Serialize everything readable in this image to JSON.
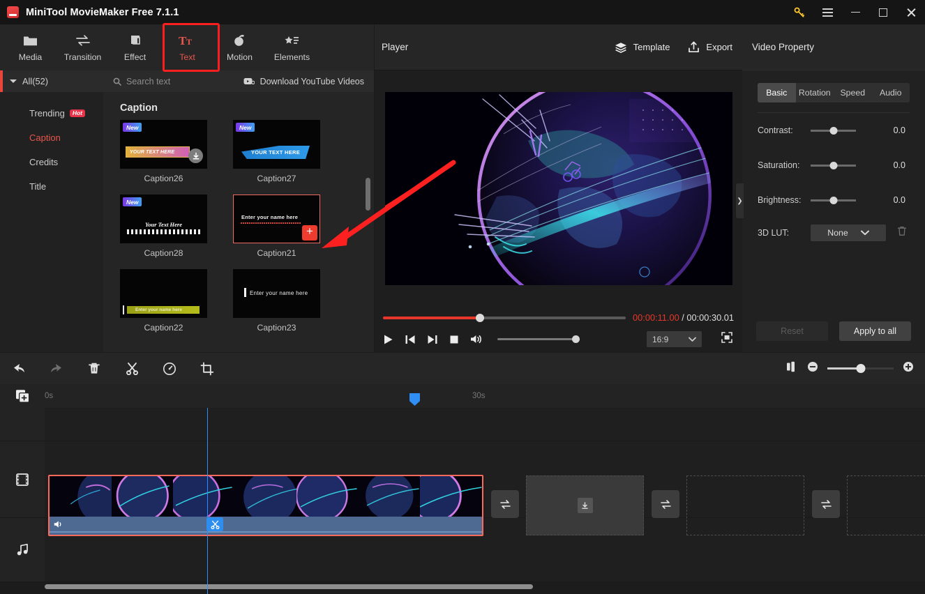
{
  "window": {
    "title": "MiniTool MovieMaker Free 7.1.1",
    "controls": {
      "key": "key-icon",
      "menu": "hamburger-icon",
      "minimize": "minimize-icon",
      "maximize": "maximize-icon",
      "close": "close-icon"
    }
  },
  "toolbar": {
    "tabs": [
      {
        "label": "Media",
        "icon": "folder-icon"
      },
      {
        "label": "Transition",
        "icon": "transition-arrows-icon"
      },
      {
        "label": "Effect",
        "icon": "layers-square-icon"
      },
      {
        "label": "Text",
        "icon": "text-tt-icon"
      },
      {
        "label": "Motion",
        "icon": "motion-ball-icon"
      },
      {
        "label": "Elements",
        "icon": "star-list-icon"
      }
    ],
    "active_tab": "Text"
  },
  "sidebar": {
    "all_label": "All(52)",
    "items": [
      {
        "label": "Trending",
        "badge": "Hot"
      },
      {
        "label": "Caption",
        "badge": ""
      },
      {
        "label": "Credits",
        "badge": ""
      },
      {
        "label": "Title",
        "badge": ""
      }
    ],
    "active_item": "Caption"
  },
  "library": {
    "search_placeholder": "Search text",
    "download_label": "Download YouTube Videos",
    "section_title": "Caption",
    "items": [
      {
        "label": "Caption26",
        "badge": "New",
        "art": "t26",
        "art_text": "YOUR TEXT HERE",
        "download": true,
        "selected": false
      },
      {
        "label": "Caption27",
        "badge": "New",
        "art": "t27",
        "art_text": "YOUR TEXT HERE",
        "download": false,
        "selected": false
      },
      {
        "label": "Caption28",
        "badge": "New",
        "art": "t28",
        "art_text": "Your Text Here",
        "download": false,
        "selected": false
      },
      {
        "label": "Caption21",
        "badge": "",
        "art": "t21",
        "art_text": "Enter your name here",
        "download": false,
        "selected": true
      },
      {
        "label": "Caption22",
        "badge": "",
        "art": "t22",
        "art_text": "Enter your name here",
        "download": false,
        "selected": false
      },
      {
        "label": "Caption23",
        "badge": "",
        "art": "t23",
        "art_text": "Enter  your  name  here",
        "download": false,
        "selected": false
      }
    ],
    "add_button_label": "+"
  },
  "player": {
    "title": "Player",
    "template_label": "Template",
    "export_label": "Export",
    "current_time": "00:00:11.00",
    "separator": "/",
    "total_time": "00:00:30.01",
    "progress_percent": 40,
    "aspect_ratio": "16:9",
    "controls": {
      "play": "play-icon",
      "prev": "previous-frame-icon",
      "next": "next-frame-icon",
      "stop": "stop-icon",
      "volume": "volume-icon",
      "fullscreen": "fullscreen-icon"
    }
  },
  "property": {
    "title": "Video Property",
    "tabs": [
      "Basic",
      "Rotation",
      "Speed",
      "Audio"
    ],
    "active_tab": "Basic",
    "sliders": [
      {
        "label": "Contrast:",
        "value": "0.0"
      },
      {
        "label": "Saturation:",
        "value": "0.0"
      },
      {
        "label": "Brightness:",
        "value": "0.0"
      }
    ],
    "lut": {
      "label": "3D LUT:",
      "value": "None"
    },
    "reset_label": "Reset",
    "apply_label": "Apply to all"
  },
  "edit_toolbar": {
    "buttons": [
      {
        "name": "undo",
        "label": "undo-icon"
      },
      {
        "name": "redo",
        "label": "redo-icon"
      },
      {
        "name": "delete",
        "label": "trash-icon"
      },
      {
        "name": "split",
        "label": "scissors-icon"
      },
      {
        "name": "speed",
        "label": "speed-gauge-icon"
      },
      {
        "name": "crop",
        "label": "crop-icon"
      }
    ],
    "split_view_icon": "split-view-icon",
    "zoom_out": "zoom-out-icon",
    "zoom_in": "zoom-in-icon",
    "zoom_percent": 50
  },
  "timeline": {
    "add_media_icon": "add-media-icon",
    "ruler_start": "0s",
    "ruler_mid": "30s",
    "tracks": [
      {
        "name": "text-track",
        "icon": ""
      },
      {
        "name": "video-track",
        "icon": "film-icon"
      },
      {
        "name": "audio-track",
        "icon": "music-note-icon"
      }
    ],
    "clip": {
      "selected": true,
      "has_audio": true,
      "mute_icon": "volume-icon",
      "split_icon": "scissors-icon"
    },
    "transition_icon": "transition-arrows-icon",
    "placeholder_download_icon": "download-icon"
  },
  "colors": {
    "accent_red": "#e8453c",
    "annotation_red": "#fc1f1f",
    "playhead_blue": "#2f8ff5",
    "clip_border": "#fb6a5b",
    "panel_bg": "#212121",
    "toolbar_bg": "#262626"
  }
}
